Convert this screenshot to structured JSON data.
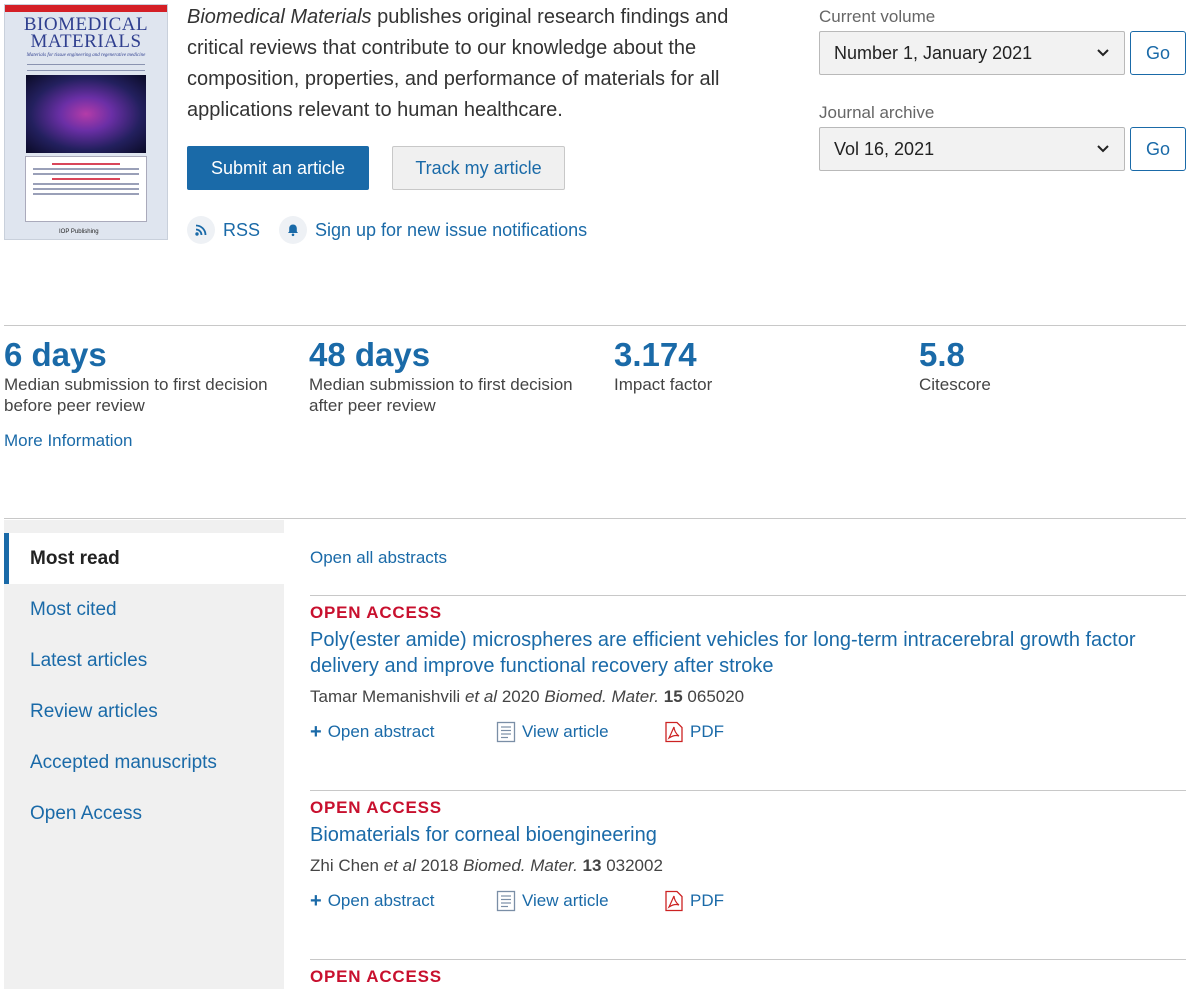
{
  "cover": {
    "title_line1": "BIOMEDICAL",
    "title_line2": "MATERIALS",
    "subtitle": "Materials for tissue engineering and regenerative medicine",
    "publisher": "IOP Publishing"
  },
  "description": {
    "journal_name": "Biomedical Materials",
    "text": " publishes original research findings and critical reviews that contribute to our knowledge about the composition, properties, and performance of materials for all applications relevant to human healthcare."
  },
  "actions": {
    "submit_label": "Submit an article",
    "track_label": "Track my article",
    "rss_label": "RSS",
    "notify_label": "Sign up for new issue notifications"
  },
  "volume": {
    "current_label": "Current volume",
    "current_value": "Number 1, January 2021",
    "archive_label": "Journal archive",
    "archive_value": "Vol 16, 2021",
    "go_label": "Go"
  },
  "metrics": [
    {
      "value": "6 days",
      "label": "Median submission to first decision before peer review"
    },
    {
      "value": "48 days",
      "label": "Median submission to first decision after peer review"
    },
    {
      "value": "3.174",
      "label": "Impact factor"
    },
    {
      "value": "5.8",
      "label": "Citescore"
    }
  ],
  "more_info_label": "More Information",
  "tabs": [
    {
      "label": "Most read",
      "active": true
    },
    {
      "label": "Most cited"
    },
    {
      "label": "Latest articles"
    },
    {
      "label": "Review articles"
    },
    {
      "label": "Accepted manuscripts"
    },
    {
      "label": "Open Access"
    }
  ],
  "open_all_label": "Open all abstracts",
  "articles": [
    {
      "badge": "OPEN ACCESS",
      "title": "Poly(ester amide) microspheres are efficient vehicles for long-term intracerebral growth factor delivery and improve functional recovery after stroke",
      "authors": "Tamar Memanishvili",
      "etal": "et al",
      "year": "2020",
      "journal": "Biomed. Mater.",
      "volume": "15",
      "article_id": "065020"
    },
    {
      "badge": "OPEN ACCESS",
      "title": "Biomaterials for corneal bioengineering",
      "authors": "Zhi Chen",
      "etal": "et al",
      "year": "2018",
      "journal": "Biomed. Mater.",
      "volume": "13",
      "article_id": "032002"
    },
    {
      "badge": "OPEN ACCESS"
    }
  ],
  "article_actions": {
    "open_abstract": "Open abstract",
    "view_article": "View article",
    "pdf": "PDF"
  },
  "colors": {
    "link_blue": "#1a6aa8",
    "open_access_red": "#c8102e",
    "sidebar_bg": "#f0f0f0"
  }
}
